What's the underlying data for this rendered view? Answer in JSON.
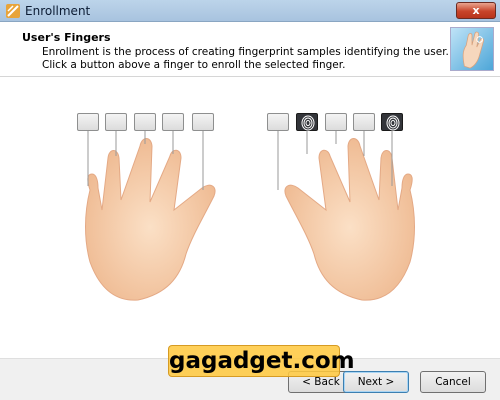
{
  "window": {
    "title": "Enrollment",
    "close_symbol": "x"
  },
  "header": {
    "title": "User's Fingers",
    "line1": "Enrollment is the process of creating fingerprint samples identifying the user.",
    "line2": "Click a button above a finger to enroll the selected finger.",
    "logo_icon": "fingerprint-hand-logo-icon"
  },
  "left_hand": {
    "fingers": [
      {
        "finger": "little",
        "enrolled": false
      },
      {
        "finger": "ring",
        "enrolled": false
      },
      {
        "finger": "middle",
        "enrolled": false
      },
      {
        "finger": "index",
        "enrolled": false
      },
      {
        "finger": "thumb",
        "enrolled": false
      }
    ]
  },
  "right_hand": {
    "fingers": [
      {
        "finger": "thumb",
        "enrolled": false
      },
      {
        "finger": "index",
        "enrolled": true
      },
      {
        "finger": "middle",
        "enrolled": false
      },
      {
        "finger": "ring",
        "enrolled": false
      },
      {
        "finger": "little",
        "enrolled": true
      }
    ]
  },
  "footer": {
    "back_label": "< Back",
    "next_label": "Next >",
    "cancel_label": "Cancel"
  },
  "watermark": {
    "text": "gagadget.com"
  },
  "colors": {
    "titlebar": "#bcd4ea",
    "skin": "#f3c9a4",
    "enrolled_button": "#33353a",
    "watermark_bg": "#ffc83c"
  }
}
